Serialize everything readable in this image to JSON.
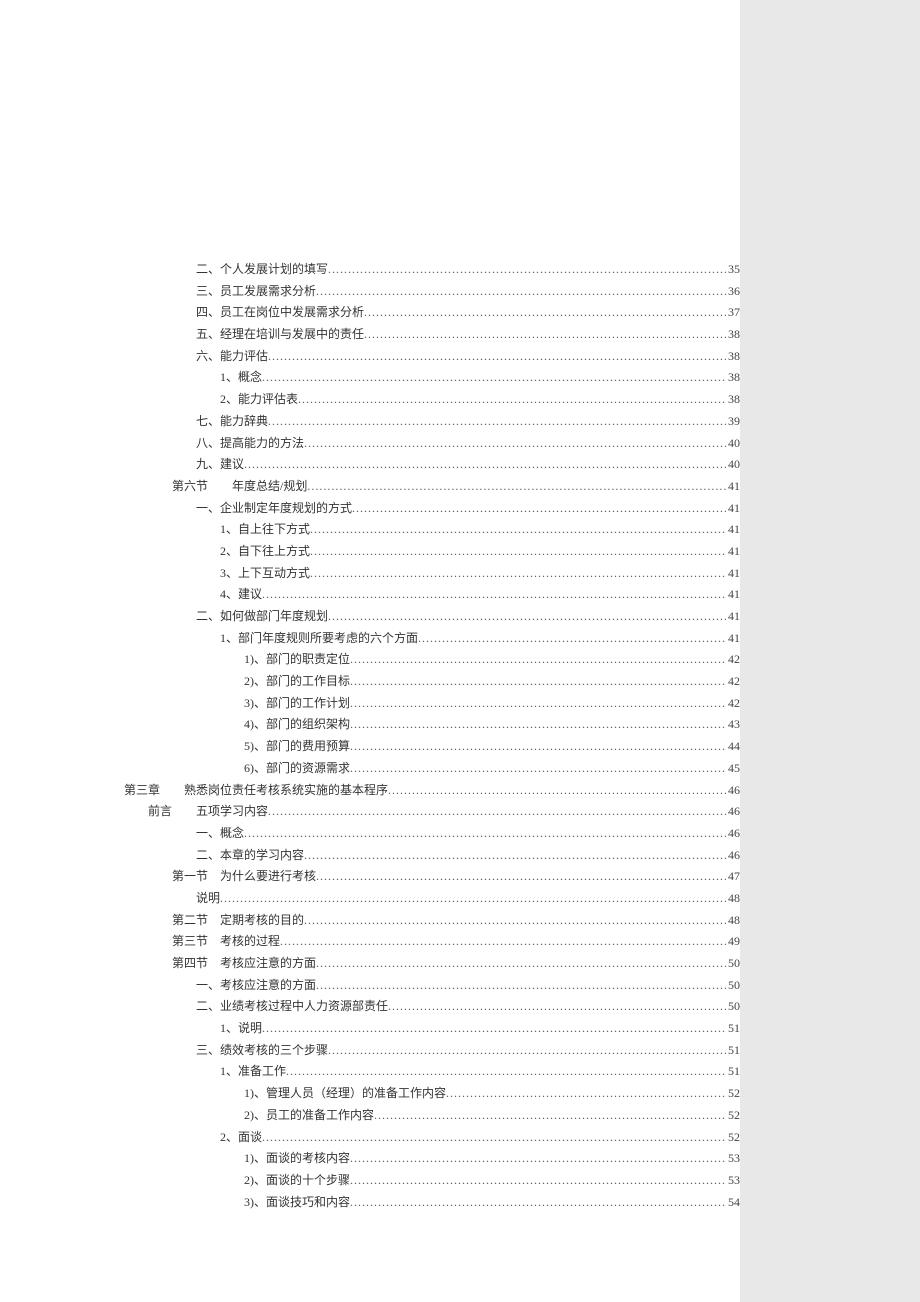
{
  "toc": [
    {
      "indent": 3,
      "text": "二、个人发展计划的填写",
      "page": "35"
    },
    {
      "indent": 3,
      "text": "三、员工发展需求分析",
      "page": "36"
    },
    {
      "indent": 3,
      "text": "四、员工在岗位中发展需求分析",
      "page": "37"
    },
    {
      "indent": 3,
      "text": "五、经理在培训与发展中的责任",
      "page": "38"
    },
    {
      "indent": 3,
      "text": "六、能力评估",
      "page": "38"
    },
    {
      "indent": 4,
      "text": "1、概念",
      "page": "38"
    },
    {
      "indent": 4,
      "text": "2、能力评估表",
      "page": "38"
    },
    {
      "indent": 3,
      "text": "七、能力辞典",
      "page": "39"
    },
    {
      "indent": 3,
      "text": "八、提高能力的方法",
      "page": "40"
    },
    {
      "indent": 3,
      "text": "九、建议",
      "page": "40"
    },
    {
      "indent": 2,
      "text": "第六节　　年度总结/规划",
      "page": "41"
    },
    {
      "indent": 3,
      "text": "一、企业制定年度规划的方式",
      "page": "41"
    },
    {
      "indent": 4,
      "text": "1、自上往下方式",
      "page": "41"
    },
    {
      "indent": 4,
      "text": "2、自下往上方式",
      "page": "41"
    },
    {
      "indent": 4,
      "text": "3、上下互动方式",
      "page": "41"
    },
    {
      "indent": 4,
      "text": "4、建议",
      "page": "41"
    },
    {
      "indent": 3,
      "text": "二、如何做部门年度规划",
      "page": "41"
    },
    {
      "indent": 4,
      "text": "1、部门年度规则所要考虑的六个方面",
      "page": "41"
    },
    {
      "indent": 5,
      "text": "1)、部门的职责定位",
      "page": "42"
    },
    {
      "indent": 5,
      "text": "2)、部门的工作目标",
      "page": "42"
    },
    {
      "indent": 5,
      "text": "3)、部门的工作计划",
      "page": "42"
    },
    {
      "indent": 5,
      "text": "4)、部门的组织架构",
      "page": "43"
    },
    {
      "indent": 5,
      "text": "5)、部门的费用预算",
      "page": "44"
    },
    {
      "indent": 5,
      "text": "6)、部门的资源需求",
      "page": "45"
    },
    {
      "indent": 0,
      "text": "第三章　　熟悉岗位责任考核系统实施的基本程序",
      "page": "46"
    },
    {
      "indent": 1,
      "text": "前言　　五项学习内容",
      "page": "46"
    },
    {
      "indent": 3,
      "text": "一、概念",
      "page": "46"
    },
    {
      "indent": 3,
      "text": "二、本章的学习内容",
      "page": "46"
    },
    {
      "indent": 2,
      "text": "第一节　为什么要进行考核",
      "page": "47"
    },
    {
      "indent": 3,
      "text": "说明",
      "page": "48"
    },
    {
      "indent": 2,
      "text": "第二节　定期考核的目的",
      "page": "48"
    },
    {
      "indent": 2,
      "text": "第三节　考核的过程",
      "page": "49"
    },
    {
      "indent": 2,
      "text": "第四节　考核应注意的方面",
      "page": "50"
    },
    {
      "indent": 3,
      "text": "一、考核应注意的方面",
      "page": "50"
    },
    {
      "indent": 3,
      "text": "二、业绩考核过程中人力资源部责任",
      "page": "50"
    },
    {
      "indent": 4,
      "text": "1、说明",
      "page": "51"
    },
    {
      "indent": 3,
      "text": "三、绩效考核的三个步骤",
      "page": "51"
    },
    {
      "indent": 4,
      "text": "1、准备工作",
      "page": "51"
    },
    {
      "indent": 5,
      "text": "1)、管理人员（经理）的准备工作内容",
      "page": "52"
    },
    {
      "indent": 5,
      "text": "2)、员工的准备工作内容",
      "page": "52"
    },
    {
      "indent": 4,
      "text": "2、面谈",
      "page": "52"
    },
    {
      "indent": 5,
      "text": "1)、面谈的考核内容",
      "page": "53"
    },
    {
      "indent": 5,
      "text": "2)、面谈的十个步骤",
      "page": "53"
    },
    {
      "indent": 5,
      "text": "3)、面谈技巧和内容",
      "page": "54"
    }
  ]
}
